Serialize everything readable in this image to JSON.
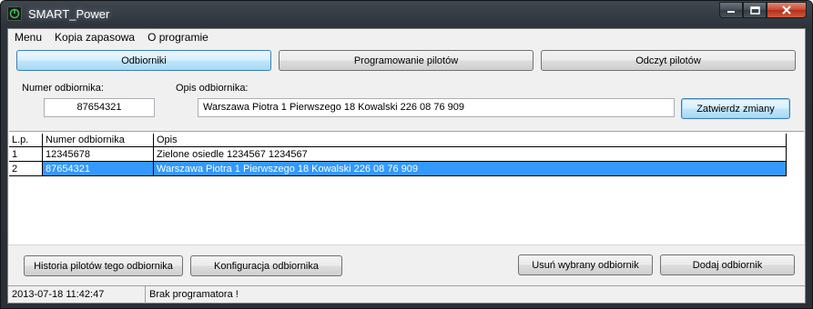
{
  "window": {
    "title": "SMART_Power"
  },
  "menu": {
    "items": [
      "Menu",
      "Kopia zapasowa",
      "O programie"
    ]
  },
  "tabs": {
    "receivers": "Odbiorniki",
    "programming": "Programowanie pilotów",
    "reading": "Odczyt pilotów"
  },
  "form": {
    "number_label": "Numer odbiornika:",
    "number_value": "87654321",
    "desc_label": "Opis odbiornika:",
    "desc_value": "Warszawa Piotra 1 Pierwszego 18 Kowalski 226 08 76 909",
    "confirm_label": "Zatwierdz zmiany"
  },
  "table": {
    "headers": [
      "L.p.",
      "Numer odbiornika",
      "Opis"
    ],
    "rows": [
      {
        "lp": "1",
        "number": "12345678",
        "desc": "Zielone osiedle 1234567 1234567"
      },
      {
        "lp": "2",
        "number": "87654321",
        "desc": "Warszawa Piotra 1 Pierwszego 18 Kowalski 226 08 76 909"
      }
    ],
    "selected_row": 2
  },
  "actions": {
    "history": "Historia pilotów tego odbiornika",
    "config": "Konfiguracja odbiornika",
    "remove": "Usuń wybrany odbiornik",
    "add": "Dodaj odbiornik"
  },
  "status": {
    "datetime": "2013-07-18 11:42:47",
    "message": "Brak programatora !"
  },
  "colors": {
    "selection": "#3399ff",
    "titlebar": "#2c323a",
    "close_button": "#c5482f"
  }
}
